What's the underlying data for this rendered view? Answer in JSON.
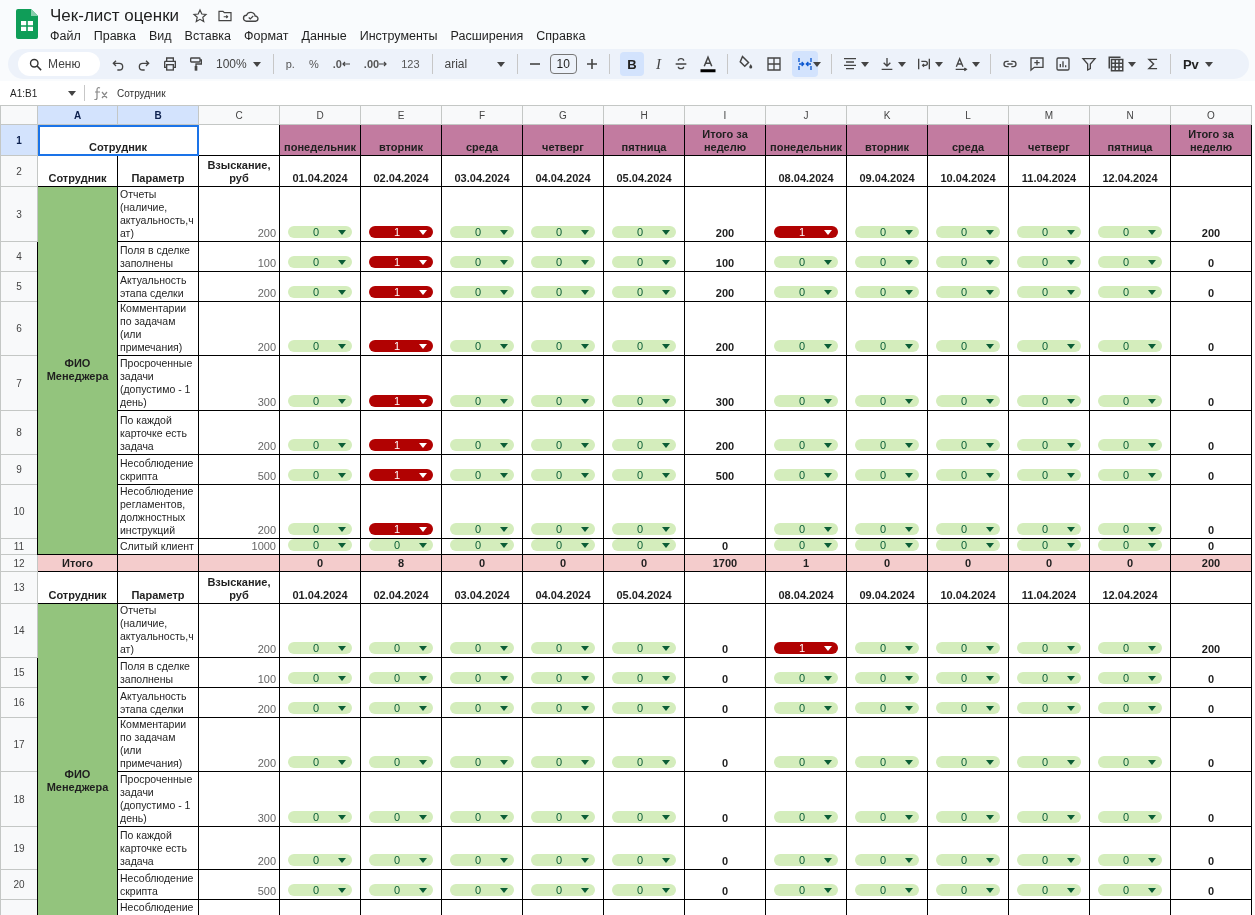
{
  "app": {
    "title": "Чек-лист оценки",
    "menu": [
      "Файл",
      "Правка",
      "Вид",
      "Вставка",
      "Формат",
      "Данные",
      "Инструменты",
      "Расширения",
      "Справка"
    ]
  },
  "toolbar": {
    "search_placeholder": "Меню",
    "zoom": "100%",
    "currency": "р.",
    "percent": "%",
    "decrease_decimals": ".0",
    "increase_decimals": ".00",
    "number_format": "123",
    "font": "arial",
    "font_size": "10",
    "bold": "B",
    "italic": "I",
    "bold_selected": true,
    "merge_selected": true,
    "addon": "Pv"
  },
  "formula_bar": {
    "range": "A1:B1",
    "value": "Сотрудник"
  },
  "sheet": {
    "columns": [
      {
        "letter": "A",
        "selected": true
      },
      {
        "letter": "B",
        "selected": true
      },
      {
        "letter": "C",
        "selected": false
      },
      {
        "letter": "D",
        "selected": false
      },
      {
        "letter": "E",
        "selected": false
      },
      {
        "letter": "F",
        "selected": false
      },
      {
        "letter": "G",
        "selected": false
      },
      {
        "letter": "H",
        "selected": false
      },
      {
        "letter": "I",
        "selected": false
      },
      {
        "letter": "J",
        "selected": false
      },
      {
        "letter": "K",
        "selected": false
      },
      {
        "letter": "L",
        "selected": false
      },
      {
        "letter": "M",
        "selected": false
      },
      {
        "letter": "N",
        "selected": false
      },
      {
        "letter": "O",
        "selected": false
      }
    ],
    "rows": [
      {
        "number": "1",
        "selected": true,
        "cells": [
          {
            "kind": "title",
            "text": "Сотрудник",
            "colspan": 2,
            "selected": true
          },
          {
            "kind": "blank"
          },
          {
            "kind": "day",
            "text": "понедельник"
          },
          {
            "kind": "day",
            "text": "вторник"
          },
          {
            "kind": "day",
            "text": "среда"
          },
          {
            "kind": "day",
            "text": "четверг"
          },
          {
            "kind": "day",
            "text": "пятница"
          },
          {
            "kind": "day",
            "text": "Итого за неделю"
          },
          {
            "kind": "day",
            "text": "понедельник"
          },
          {
            "kind": "day",
            "text": "вторник"
          },
          {
            "kind": "day",
            "text": "среда"
          },
          {
            "kind": "day",
            "text": "четверг"
          },
          {
            "kind": "day",
            "text": "пятница"
          },
          {
            "kind": "day",
            "text": "Итого за неделю"
          }
        ]
      },
      {
        "number": "2",
        "selected": false,
        "cells": [
          {
            "kind": "title",
            "text": "Сотрудник"
          },
          {
            "kind": "title",
            "text": "Параметр"
          },
          {
            "kind": "title",
            "text": "Взыскание, руб"
          },
          {
            "kind": "title",
            "text": "01.04.2024"
          },
          {
            "kind": "title",
            "text": "02.04.2024"
          },
          {
            "kind": "title",
            "text": "03.04.2024"
          },
          {
            "kind": "title",
            "text": "04.04.2024"
          },
          {
            "kind": "title",
            "text": "05.04.2024"
          },
          {
            "kind": "blank"
          },
          {
            "kind": "title",
            "text": "08.04.2024"
          },
          {
            "kind": "title",
            "text": "09.04.2024"
          },
          {
            "kind": "title",
            "text": "10.04.2024"
          },
          {
            "kind": "title",
            "text": "11.04.2024"
          },
          {
            "kind": "title",
            "text": "12.04.2024"
          },
          {
            "kind": "blank"
          }
        ]
      },
      {
        "number": "3",
        "selected": false,
        "cells": [
          {
            "kind": "employee",
            "text": "ФИО Менеджера",
            "rowspan": 9
          },
          {
            "kind": "param",
            "text": "Отчеты (наличие, актуальность,чат)"
          },
          {
            "kind": "amount",
            "text": "200"
          },
          {
            "kind": "chip",
            "text": "0",
            "flagged": false
          },
          {
            "kind": "chip",
            "text": "1",
            "flagged": true
          },
          {
            "kind": "chip",
            "text": "0",
            "flagged": false
          },
          {
            "kind": "chip",
            "text": "0",
            "flagged": false
          },
          {
            "kind": "chip",
            "text": "0",
            "flagged": false
          },
          {
            "kind": "total",
            "text": "200"
          },
          {
            "kind": "chip",
            "text": "1",
            "flagged": true
          },
          {
            "kind": "chip",
            "text": "0",
            "flagged": false
          },
          {
            "kind": "chip",
            "text": "0",
            "flagged": false
          },
          {
            "kind": "chip",
            "text": "0",
            "flagged": false
          },
          {
            "kind": "chip",
            "text": "0",
            "flagged": false
          },
          {
            "kind": "total",
            "text": "200"
          }
        ]
      },
      {
        "number": "4",
        "selected": false,
        "cells": [
          {
            "kind": "param",
            "text": "Поля в сделке заполнены"
          },
          {
            "kind": "amount",
            "text": "100"
          },
          {
            "kind": "chip",
            "text": "0",
            "flagged": false
          },
          {
            "kind": "chip",
            "text": "1",
            "flagged": true
          },
          {
            "kind": "chip",
            "text": "0",
            "flagged": false
          },
          {
            "kind": "chip",
            "text": "0",
            "flagged": false
          },
          {
            "kind": "chip",
            "text": "0",
            "flagged": false
          },
          {
            "kind": "total",
            "text": "100"
          },
          {
            "kind": "chip",
            "text": "0",
            "flagged": false
          },
          {
            "kind": "chip",
            "text": "0",
            "flagged": false
          },
          {
            "kind": "chip",
            "text": "0",
            "flagged": false
          },
          {
            "kind": "chip",
            "text": "0",
            "flagged": false
          },
          {
            "kind": "chip",
            "text": "0",
            "flagged": false
          },
          {
            "kind": "total",
            "text": "0"
          }
        ]
      },
      {
        "number": "5",
        "selected": false,
        "cells": [
          {
            "kind": "param",
            "text": "Актуальность этапа сделки"
          },
          {
            "kind": "amount",
            "text": "200"
          },
          {
            "kind": "chip",
            "text": "0",
            "flagged": false
          },
          {
            "kind": "chip",
            "text": "1",
            "flagged": true
          },
          {
            "kind": "chip",
            "text": "0",
            "flagged": false
          },
          {
            "kind": "chip",
            "text": "0",
            "flagged": false
          },
          {
            "kind": "chip",
            "text": "0",
            "flagged": false
          },
          {
            "kind": "total",
            "text": "200"
          },
          {
            "kind": "chip",
            "text": "0",
            "flagged": false
          },
          {
            "kind": "chip",
            "text": "0",
            "flagged": false
          },
          {
            "kind": "chip",
            "text": "0",
            "flagged": false
          },
          {
            "kind": "chip",
            "text": "0",
            "flagged": false
          },
          {
            "kind": "chip",
            "text": "0",
            "flagged": false
          },
          {
            "kind": "total",
            "text": "0"
          }
        ]
      },
      {
        "number": "6",
        "selected": false,
        "cells": [
          {
            "kind": "param",
            "text": "Комментарии по задачам (или примечания)"
          },
          {
            "kind": "amount",
            "text": "200"
          },
          {
            "kind": "chip",
            "text": "0",
            "flagged": false
          },
          {
            "kind": "chip",
            "text": "1",
            "flagged": true
          },
          {
            "kind": "chip",
            "text": "0",
            "flagged": false
          },
          {
            "kind": "chip",
            "text": "0",
            "flagged": false
          },
          {
            "kind": "chip",
            "text": "0",
            "flagged": false
          },
          {
            "kind": "total",
            "text": "200"
          },
          {
            "kind": "chip",
            "text": "0",
            "flagged": false
          },
          {
            "kind": "chip",
            "text": "0",
            "flagged": false
          },
          {
            "kind": "chip",
            "text": "0",
            "flagged": false
          },
          {
            "kind": "chip",
            "text": "0",
            "flagged": false
          },
          {
            "kind": "chip",
            "text": "0",
            "flagged": false
          },
          {
            "kind": "total",
            "text": "0"
          }
        ]
      },
      {
        "number": "7",
        "selected": false,
        "cells": [
          {
            "kind": "param",
            "text": "Просроченные задачи (допустимо - 1 день)"
          },
          {
            "kind": "amount",
            "text": "300"
          },
          {
            "kind": "chip",
            "text": "0",
            "flagged": false
          },
          {
            "kind": "chip",
            "text": "1",
            "flagged": true
          },
          {
            "kind": "chip",
            "text": "0",
            "flagged": false
          },
          {
            "kind": "chip",
            "text": "0",
            "flagged": false
          },
          {
            "kind": "chip",
            "text": "0",
            "flagged": false
          },
          {
            "kind": "total",
            "text": "300"
          },
          {
            "kind": "chip",
            "text": "0",
            "flagged": false
          },
          {
            "kind": "chip",
            "text": "0",
            "flagged": false
          },
          {
            "kind": "chip",
            "text": "0",
            "flagged": false
          },
          {
            "kind": "chip",
            "text": "0",
            "flagged": false
          },
          {
            "kind": "chip",
            "text": "0",
            "flagged": false
          },
          {
            "kind": "total",
            "text": "0"
          }
        ]
      },
      {
        "number": "8",
        "selected": false,
        "cells": [
          {
            "kind": "param",
            "text": "По каждой карточке есть задача"
          },
          {
            "kind": "amount",
            "text": "200"
          },
          {
            "kind": "chip",
            "text": "0",
            "flagged": false
          },
          {
            "kind": "chip",
            "text": "1",
            "flagged": true
          },
          {
            "kind": "chip",
            "text": "0",
            "flagged": false
          },
          {
            "kind": "chip",
            "text": "0",
            "flagged": false
          },
          {
            "kind": "chip",
            "text": "0",
            "flagged": false
          },
          {
            "kind": "total",
            "text": "200"
          },
          {
            "kind": "chip",
            "text": "0",
            "flagged": false
          },
          {
            "kind": "chip",
            "text": "0",
            "flagged": false
          },
          {
            "kind": "chip",
            "text": "0",
            "flagged": false
          },
          {
            "kind": "chip",
            "text": "0",
            "flagged": false
          },
          {
            "kind": "chip",
            "text": "0",
            "flagged": false
          },
          {
            "kind": "total",
            "text": "0"
          }
        ]
      },
      {
        "number": "9",
        "selected": false,
        "cells": [
          {
            "kind": "param",
            "text": "Несоблюдение скрипта"
          },
          {
            "kind": "amount",
            "text": "500"
          },
          {
            "kind": "chip",
            "text": "0",
            "flagged": false
          },
          {
            "kind": "chip",
            "text": "1",
            "flagged": true
          },
          {
            "kind": "chip",
            "text": "0",
            "flagged": false
          },
          {
            "kind": "chip",
            "text": "0",
            "flagged": false
          },
          {
            "kind": "chip",
            "text": "0",
            "flagged": false
          },
          {
            "kind": "total",
            "text": "500"
          },
          {
            "kind": "chip",
            "text": "0",
            "flagged": false
          },
          {
            "kind": "chip",
            "text": "0",
            "flagged": false
          },
          {
            "kind": "chip",
            "text": "0",
            "flagged": false
          },
          {
            "kind": "chip",
            "text": "0",
            "flagged": false
          },
          {
            "kind": "chip",
            "text": "0",
            "flagged": false
          },
          {
            "kind": "total",
            "text": "0"
          }
        ]
      },
      {
        "number": "10",
        "selected": false,
        "cells": [
          {
            "kind": "param",
            "text": "Несоблюдение регламентов, должностных инструкций"
          },
          {
            "kind": "amount",
            "text": "200"
          },
          {
            "kind": "chip",
            "text": "0",
            "flagged": false
          },
          {
            "kind": "chip",
            "text": "1",
            "flagged": true
          },
          {
            "kind": "chip",
            "text": "0",
            "flagged": false
          },
          {
            "kind": "chip",
            "text": "0",
            "flagged": false
          },
          {
            "kind": "chip",
            "text": "0",
            "flagged": false
          },
          {
            "kind": "blank"
          },
          {
            "kind": "chip",
            "text": "0",
            "flagged": false
          },
          {
            "kind": "chip",
            "text": "0",
            "flagged": false
          },
          {
            "kind": "chip",
            "text": "0",
            "flagged": false
          },
          {
            "kind": "chip",
            "text": "0",
            "flagged": false
          },
          {
            "kind": "chip",
            "text": "0",
            "flagged": false
          },
          {
            "kind": "total",
            "text": "0"
          }
        ]
      },
      {
        "number": "11",
        "selected": false,
        "cells": [
          {
            "kind": "param",
            "text": "Слитый клиент"
          },
          {
            "kind": "amount",
            "text": "1000"
          },
          {
            "kind": "chip",
            "text": "0",
            "flagged": false
          },
          {
            "kind": "chip",
            "text": "0",
            "flagged": false
          },
          {
            "kind": "chip",
            "text": "0",
            "flagged": false
          },
          {
            "kind": "chip",
            "text": "0",
            "flagged": false
          },
          {
            "kind": "chip",
            "text": "0",
            "flagged": false
          },
          {
            "kind": "total",
            "text": "0"
          },
          {
            "kind": "chip",
            "text": "0",
            "flagged": false
          },
          {
            "kind": "chip",
            "text": "0",
            "flagged": false
          },
          {
            "kind": "chip",
            "text": "0",
            "flagged": false
          },
          {
            "kind": "chip",
            "text": "0",
            "flagged": false
          },
          {
            "kind": "chip",
            "text": "0",
            "flagged": false
          },
          {
            "kind": "total",
            "text": "0"
          }
        ]
      },
      {
        "number": "12",
        "selected": false,
        "cells": [
          {
            "kind": "sum",
            "text": "Итого"
          },
          {
            "kind": "sum"
          },
          {
            "kind": "sum"
          },
          {
            "kind": "sum",
            "text": "0"
          },
          {
            "kind": "sum",
            "text": "8"
          },
          {
            "kind": "sum",
            "text": "0"
          },
          {
            "kind": "sum",
            "text": "0"
          },
          {
            "kind": "sum",
            "text": "0"
          },
          {
            "kind": "sum",
            "text": "1700"
          },
          {
            "kind": "sum",
            "text": "1"
          },
          {
            "kind": "sum",
            "text": "0"
          },
          {
            "kind": "sum",
            "text": "0"
          },
          {
            "kind": "sum",
            "text": "0"
          },
          {
            "kind": "sum",
            "text": "0"
          },
          {
            "kind": "sum",
            "text": "200"
          }
        ]
      },
      {
        "number": "13",
        "selected": false,
        "cells": [
          {
            "kind": "title",
            "text": "Сотрудник"
          },
          {
            "kind": "title",
            "text": "Параметр"
          },
          {
            "kind": "title",
            "text": "Взыскание, руб"
          },
          {
            "kind": "title",
            "text": "01.04.2024"
          },
          {
            "kind": "title",
            "text": "02.04.2024"
          },
          {
            "kind": "title",
            "text": "03.04.2024"
          },
          {
            "kind": "title",
            "text": "04.04.2024"
          },
          {
            "kind": "title",
            "text": "05.04.2024"
          },
          {
            "kind": "blank"
          },
          {
            "kind": "title",
            "text": "08.04.2024"
          },
          {
            "kind": "title",
            "text": "09.04.2024"
          },
          {
            "kind": "title",
            "text": "10.04.2024"
          },
          {
            "kind": "title",
            "text": "11.04.2024"
          },
          {
            "kind": "title",
            "text": "12.04.2024"
          },
          {
            "kind": "blank"
          }
        ]
      },
      {
        "number": "14",
        "selected": false,
        "cells": [
          {
            "kind": "employee",
            "text": "ФИО Менеджера",
            "rowspan": 8
          },
          {
            "kind": "param",
            "text": "Отчеты (наличие, актуальность,чат)"
          },
          {
            "kind": "amount",
            "text": "200"
          },
          {
            "kind": "chip",
            "text": "0",
            "flagged": false
          },
          {
            "kind": "chip",
            "text": "0",
            "flagged": false
          },
          {
            "kind": "chip",
            "text": "0",
            "flagged": false
          },
          {
            "kind": "chip",
            "text": "0",
            "flagged": false
          },
          {
            "kind": "chip",
            "text": "0",
            "flagged": false
          },
          {
            "kind": "total",
            "text": "0"
          },
          {
            "kind": "chip",
            "text": "1",
            "flagged": true
          },
          {
            "kind": "chip",
            "text": "0",
            "flagged": false
          },
          {
            "kind": "chip",
            "text": "0",
            "flagged": false
          },
          {
            "kind": "chip",
            "text": "0",
            "flagged": false
          },
          {
            "kind": "chip",
            "text": "0",
            "flagged": false
          },
          {
            "kind": "total",
            "text": "200"
          }
        ]
      },
      {
        "number": "15",
        "selected": false,
        "cells": [
          {
            "kind": "param",
            "text": "Поля в сделке заполнены"
          },
          {
            "kind": "amount",
            "text": "100"
          },
          {
            "kind": "chip",
            "text": "0",
            "flagged": false
          },
          {
            "kind": "chip",
            "text": "0",
            "flagged": false
          },
          {
            "kind": "chip",
            "text": "0",
            "flagged": false
          },
          {
            "kind": "chip",
            "text": "0",
            "flagged": false
          },
          {
            "kind": "chip",
            "text": "0",
            "flagged": false
          },
          {
            "kind": "total",
            "text": "0"
          },
          {
            "kind": "chip",
            "text": "0",
            "flagged": false
          },
          {
            "kind": "chip",
            "text": "0",
            "flagged": false
          },
          {
            "kind": "chip",
            "text": "0",
            "flagged": false
          },
          {
            "kind": "chip",
            "text": "0",
            "flagged": false
          },
          {
            "kind": "chip",
            "text": "0",
            "flagged": false
          },
          {
            "kind": "total",
            "text": "0"
          }
        ]
      },
      {
        "number": "16",
        "selected": false,
        "cells": [
          {
            "kind": "param",
            "text": "Актуальность этапа сделки"
          },
          {
            "kind": "amount",
            "text": "200"
          },
          {
            "kind": "chip",
            "text": "0",
            "flagged": false
          },
          {
            "kind": "chip",
            "text": "0",
            "flagged": false
          },
          {
            "kind": "chip",
            "text": "0",
            "flagged": false
          },
          {
            "kind": "chip",
            "text": "0",
            "flagged": false
          },
          {
            "kind": "chip",
            "text": "0",
            "flagged": false
          },
          {
            "kind": "total",
            "text": "0"
          },
          {
            "kind": "chip",
            "text": "0",
            "flagged": false
          },
          {
            "kind": "chip",
            "text": "0",
            "flagged": false
          },
          {
            "kind": "chip",
            "text": "0",
            "flagged": false
          },
          {
            "kind": "chip",
            "text": "0",
            "flagged": false
          },
          {
            "kind": "chip",
            "text": "0",
            "flagged": false
          },
          {
            "kind": "total",
            "text": "0"
          }
        ]
      },
      {
        "number": "17",
        "selected": false,
        "cells": [
          {
            "kind": "param",
            "text": "Комментарии по задачам (или примечания)"
          },
          {
            "kind": "amount",
            "text": "200"
          },
          {
            "kind": "chip",
            "text": "0",
            "flagged": false
          },
          {
            "kind": "chip",
            "text": "0",
            "flagged": false
          },
          {
            "kind": "chip",
            "text": "0",
            "flagged": false
          },
          {
            "kind": "chip",
            "text": "0",
            "flagged": false
          },
          {
            "kind": "chip",
            "text": "0",
            "flagged": false
          },
          {
            "kind": "total",
            "text": "0"
          },
          {
            "kind": "chip",
            "text": "0",
            "flagged": false
          },
          {
            "kind": "chip",
            "text": "0",
            "flagged": false
          },
          {
            "kind": "chip",
            "text": "0",
            "flagged": false
          },
          {
            "kind": "chip",
            "text": "0",
            "flagged": false
          },
          {
            "kind": "chip",
            "text": "0",
            "flagged": false
          },
          {
            "kind": "total",
            "text": "0"
          }
        ]
      },
      {
        "number": "18",
        "selected": false,
        "cells": [
          {
            "kind": "param",
            "text": "Просроченные задачи (допустимо - 1 день)"
          },
          {
            "kind": "amount",
            "text": "300"
          },
          {
            "kind": "chip",
            "text": "0",
            "flagged": false
          },
          {
            "kind": "chip",
            "text": "0",
            "flagged": false
          },
          {
            "kind": "chip",
            "text": "0",
            "flagged": false
          },
          {
            "kind": "chip",
            "text": "0",
            "flagged": false
          },
          {
            "kind": "chip",
            "text": "0",
            "flagged": false
          },
          {
            "kind": "total",
            "text": "0"
          },
          {
            "kind": "chip",
            "text": "0",
            "flagged": false
          },
          {
            "kind": "chip",
            "text": "0",
            "flagged": false
          },
          {
            "kind": "chip",
            "text": "0",
            "flagged": false
          },
          {
            "kind": "chip",
            "text": "0",
            "flagged": false
          },
          {
            "kind": "chip",
            "text": "0",
            "flagged": false
          },
          {
            "kind": "total",
            "text": "0"
          }
        ]
      },
      {
        "number": "19",
        "selected": false,
        "cells": [
          {
            "kind": "param",
            "text": "По каждой карточке есть задача"
          },
          {
            "kind": "amount",
            "text": "200"
          },
          {
            "kind": "chip",
            "text": "0",
            "flagged": false
          },
          {
            "kind": "chip",
            "text": "0",
            "flagged": false
          },
          {
            "kind": "chip",
            "text": "0",
            "flagged": false
          },
          {
            "kind": "chip",
            "text": "0",
            "flagged": false
          },
          {
            "kind": "chip",
            "text": "0",
            "flagged": false
          },
          {
            "kind": "total",
            "text": "0"
          },
          {
            "kind": "chip",
            "text": "0",
            "flagged": false
          },
          {
            "kind": "chip",
            "text": "0",
            "flagged": false
          },
          {
            "kind": "chip",
            "text": "0",
            "flagged": false
          },
          {
            "kind": "chip",
            "text": "0",
            "flagged": false
          },
          {
            "kind": "chip",
            "text": "0",
            "flagged": false
          },
          {
            "kind": "total",
            "text": "0"
          }
        ]
      },
      {
        "number": "20",
        "selected": false,
        "cells": [
          {
            "kind": "param",
            "text": "Несоблюдение скрипта"
          },
          {
            "kind": "amount",
            "text": "500"
          },
          {
            "kind": "chip",
            "text": "0",
            "flagged": false
          },
          {
            "kind": "chip",
            "text": "0",
            "flagged": false
          },
          {
            "kind": "chip",
            "text": "0",
            "flagged": false
          },
          {
            "kind": "chip",
            "text": "0",
            "flagged": false
          },
          {
            "kind": "chip",
            "text": "0",
            "flagged": false
          },
          {
            "kind": "total",
            "text": "0"
          },
          {
            "kind": "chip",
            "text": "0",
            "flagged": false
          },
          {
            "kind": "chip",
            "text": "0",
            "flagged": false
          },
          {
            "kind": "chip",
            "text": "0",
            "flagged": false
          },
          {
            "kind": "chip",
            "text": "0",
            "flagged": false
          },
          {
            "kind": "chip",
            "text": "0",
            "flagged": false
          },
          {
            "kind": "total",
            "text": "0"
          }
        ]
      },
      {
        "cells": [
          {
            "kind": "param",
            "text": "Несоблюдение"
          },
          {
            "kind": "blank"
          },
          {
            "kind": "blank"
          },
          {
            "kind": "blank"
          },
          {
            "kind": "blank"
          },
          {
            "kind": "blank"
          },
          {
            "kind": "blank"
          },
          {
            "kind": "blank"
          },
          {
            "kind": "blank"
          },
          {
            "kind": "blank"
          },
          {
            "kind": "blank"
          },
          {
            "kind": "blank"
          },
          {
            "kind": "blank"
          },
          {
            "kind": "blank"
          }
        ]
      }
    ]
  }
}
